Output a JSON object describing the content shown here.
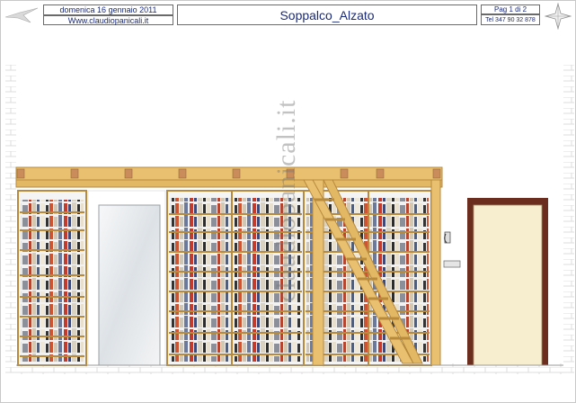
{
  "header": {
    "date": "domenica 16 gennaio 2011",
    "website": "Www.claudiopanicali.it",
    "title": "Soppalco_Alzato",
    "page": "Pag 1 di 2",
    "phone": "Tel 347 90 32 878"
  },
  "drawing": {
    "watermark": "claudiopanicali.it",
    "colors": {
      "wood": "#e8c070",
      "wood_dark": "#b78a3c",
      "door_frame": "#6b2e1e",
      "door_panel": "#f7eecf",
      "mirror": "#e9edf0",
      "brick_line": "#d6d6d6"
    }
  }
}
